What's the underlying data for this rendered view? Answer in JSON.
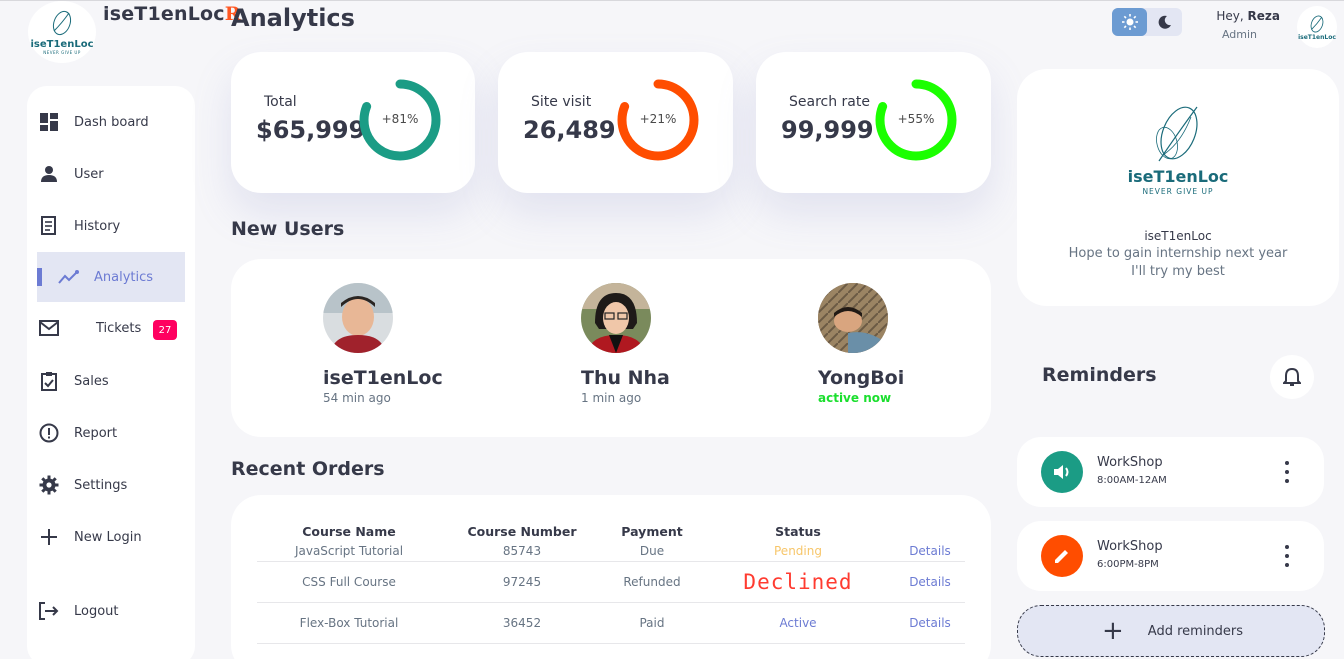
{
  "brand": {
    "name_main": "iseT1enLoc",
    "name_accent": "R",
    "logo_text": "iseT1enLoc",
    "logo_tagline": "NEVER GIVE UP"
  },
  "page": {
    "title": "Analytics"
  },
  "sidebar": {
    "items": [
      {
        "label": "Dash board",
        "icon": "dashboard-icon"
      },
      {
        "label": "User",
        "icon": "user-icon"
      },
      {
        "label": "History",
        "icon": "history-icon"
      },
      {
        "label": "Analytics",
        "icon": "analytics-icon",
        "active": true
      },
      {
        "label": "Tickets",
        "icon": "mail-icon",
        "badge": "27"
      },
      {
        "label": "Sales",
        "icon": "clipboard-icon"
      },
      {
        "label": "Report",
        "icon": "report-icon"
      },
      {
        "label": "Settings",
        "icon": "gear-icon"
      },
      {
        "label": "New Login",
        "icon": "plus-icon"
      },
      {
        "label": "Logout",
        "icon": "logout-icon"
      }
    ]
  },
  "stats": [
    {
      "label": "Total",
      "value": "$65,999",
      "percent": "+81%",
      "fill": 0.81,
      "color": "#1b9c85"
    },
    {
      "label": "Site visit",
      "value": "26,489",
      "percent": "+21%",
      "fill": 0.81,
      "color": "#ff4d00"
    },
    {
      "label": "Search rate",
      "value": "99,999",
      "percent": "+55%",
      "fill": 0.81,
      "color": "#1bff00"
    }
  ],
  "new_users": {
    "title": "New Users",
    "users": [
      {
        "name": "iseT1enLoc",
        "time": "54 min ago",
        "online": false
      },
      {
        "name": "Thu Nha",
        "time": "1 min ago",
        "online": false
      },
      {
        "name": "YongBoi",
        "time": "active now",
        "online": true
      }
    ]
  },
  "orders": {
    "title": "Recent Orders",
    "columns": [
      "Course Name",
      "Course Number",
      "Payment",
      "Status",
      ""
    ],
    "rows": [
      {
        "course": "JavaScript Tutorial",
        "number": "85743",
        "payment": "Due",
        "status": "Pending",
        "link": "Details"
      },
      {
        "course": "CSS Full Course",
        "number": "97245",
        "payment": "Refunded",
        "status": "Declined",
        "link": "Details"
      },
      {
        "course": "Flex-Box Tutorial",
        "number": "36452",
        "payment": "Paid",
        "status": "Active",
        "link": "Details"
      }
    ]
  },
  "header": {
    "greeting": "Hey, ",
    "user": "Reza",
    "role": "Admin",
    "theme": "light"
  },
  "about": {
    "logo_text": "iseT1enLoc",
    "logo_tagline": "NEVER GIVE UP",
    "name": "iseT1enLoc",
    "line1": "Hope to gain internship next year",
    "line2": "I'll try my best"
  },
  "reminders": {
    "title": "Reminders",
    "items": [
      {
        "name": "WorkShop",
        "time": "8:00AM-12AM",
        "icon": "volume-icon",
        "color": "#1b9c85"
      },
      {
        "name": "WorkShop",
        "time": "6:00PM-8PM",
        "icon": "edit-icon",
        "color": "#ff4d00"
      }
    ],
    "add_label": "Add reminders"
  }
}
